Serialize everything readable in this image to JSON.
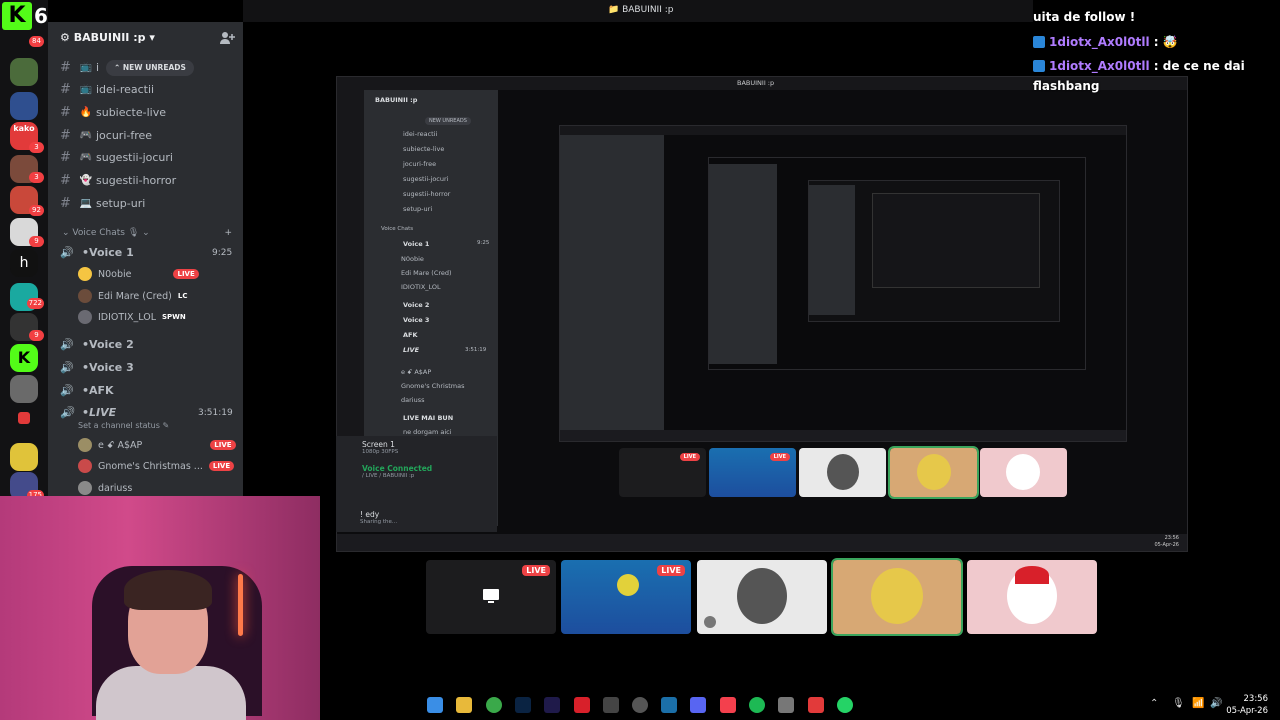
{
  "overlay": {
    "kick_logo": "K",
    "viewer_count": "6"
  },
  "rail_badges": [
    "84",
    "3",
    "3",
    "92",
    "9",
    "722",
    "9",
    "175"
  ],
  "server": {
    "name": "BABUINII :p",
    "name_chevron": "▾"
  },
  "window": {
    "title": "BABUINII :p"
  },
  "new_unreads_label": "NEW UNREADS",
  "channels": [
    {
      "emoji": "📺",
      "name": "i"
    },
    {
      "emoji": "📺",
      "name": "idei-reactii"
    },
    {
      "emoji": "🔥",
      "name": "subiecte-live"
    },
    {
      "emoji": "🎮",
      "name": "jocuri-free"
    },
    {
      "emoji": "🎮",
      "name": "sugestii-jocuri"
    },
    {
      "emoji": "👻",
      "name": "sugestii-horror"
    },
    {
      "emoji": "💻",
      "name": "setup-uri"
    }
  ],
  "category": {
    "label": "Voice Chats",
    "emoji": "🎙"
  },
  "voice": {
    "voice1": {
      "name": "Voice 1",
      "time": "9:25"
    },
    "users1": [
      {
        "name": "N0obie",
        "badge": "LIVE",
        "color": "#f5c542"
      },
      {
        "name": "Edi Mare (Cred)",
        "tag": "LC",
        "color": "#6b4c3b"
      },
      {
        "name": "IDIOTIX_LOL",
        "tag": "SPWN",
        "color": "#6a6a72"
      }
    ],
    "voice2": "Voice 2",
    "voice3": "Voice 3",
    "afk": "AFK",
    "live": {
      "name": "LIVE",
      "time": "3:51:19",
      "status": "Set a channel status"
    },
    "users2": [
      {
        "name": "e ꗃ A$AP",
        "badge": "LIVE",
        "color": "#9b8e65"
      },
      {
        "name": "Gnome's Christmas ...",
        "badge": "LIVE",
        "color": "#c94a4a"
      },
      {
        "name": "dariuss",
        "color": "#8a8a8a"
      }
    ]
  },
  "nested": {
    "channels": [
      "idei-reactii",
      "subiecte-live",
      "jocuri-free",
      "sugestii-jocuri",
      "sugestii-horror",
      "setup-uri"
    ],
    "voice_users": [
      "N0obie",
      "Edi Mare (Cred)",
      "IDIOTIX_LOL"
    ],
    "voice2": "Voice 2",
    "voice3": "Voice 3",
    "afk": "AFK",
    "live": "LIVE",
    "live_time": "3:51:19",
    "live_users": [
      "e ꗃ A$AP",
      "Gnome's Christmas",
      "dariuss"
    ],
    "live_mai_bun": "LIVE MAI BUN",
    "ne_dorgam": "ne dorgam aici",
    "screen": "Screen 1",
    "screen_sub": "1080p 30FPS",
    "voice_connected": "Voice Connected",
    "voice_connected_sub": "/ LIVE / BABUINII :p",
    "user": "! edy",
    "user_sub": "Sharing the...",
    "live_badge": "LIVE",
    "taskbar_time": "23:56",
    "taskbar_date": "05-Apr-26"
  },
  "tiles": [
    {
      "name": "screen-share",
      "live": "LIVE"
    },
    {
      "name": "game-stream",
      "live": "LIVE"
    },
    {
      "name": "dariuss-avatar"
    },
    {
      "name": "spongebob-avatar"
    },
    {
      "name": "santa-avatar"
    }
  ],
  "chat": {
    "line0": "uita de follow !",
    "line1_user": "1diotx_Ax0l0tll",
    "line1_text": ": 🤯",
    "line2_user": "1diotx_Ax0l0tll",
    "line2_text": ": de ce ne dai",
    "line3": "flashbang"
  },
  "taskbar": {
    "time": "23:56",
    "date": "05-Apr-26"
  },
  "colors": {
    "accent_live": "#ed4245",
    "kick_green": "#53fc18",
    "discord_sidebar": "#2b2d31",
    "select_green": "#3ba55d"
  }
}
